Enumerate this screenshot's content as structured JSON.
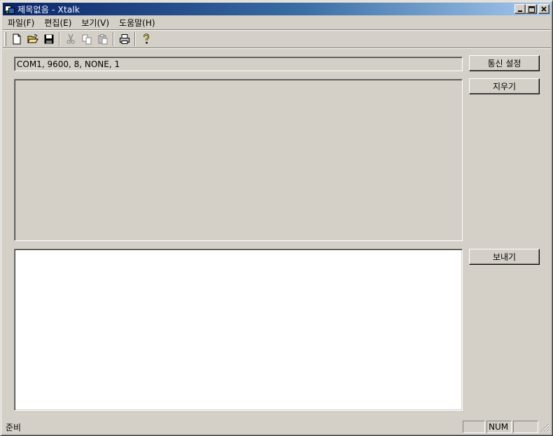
{
  "window": {
    "title": "제목없음 - Xtalk"
  },
  "menu": [
    {
      "label": "파일(F)"
    },
    {
      "label": "편집(E)"
    },
    {
      "label": "보기(V)"
    },
    {
      "label": "도움말(H)"
    }
  ],
  "toolbar": {
    "icons": [
      "new-file-icon",
      "open-folder-icon",
      "save-disk-icon",
      "cut-scissors-icon",
      "copy-icon",
      "paste-icon",
      "print-icon",
      "help-icon"
    ]
  },
  "connection": {
    "status": "COM1, 9600, 8, NONE, 1"
  },
  "buttons": {
    "settings": "통신 설정",
    "clear": "지우기",
    "send": "보내기"
  },
  "statusbar": {
    "text": "준비",
    "pane_num": "NUM"
  },
  "colors": {
    "face": "#d4d0c8",
    "title_start": "#0a246a",
    "title_end": "#a6caf0",
    "input_bg": "#ffffff"
  }
}
